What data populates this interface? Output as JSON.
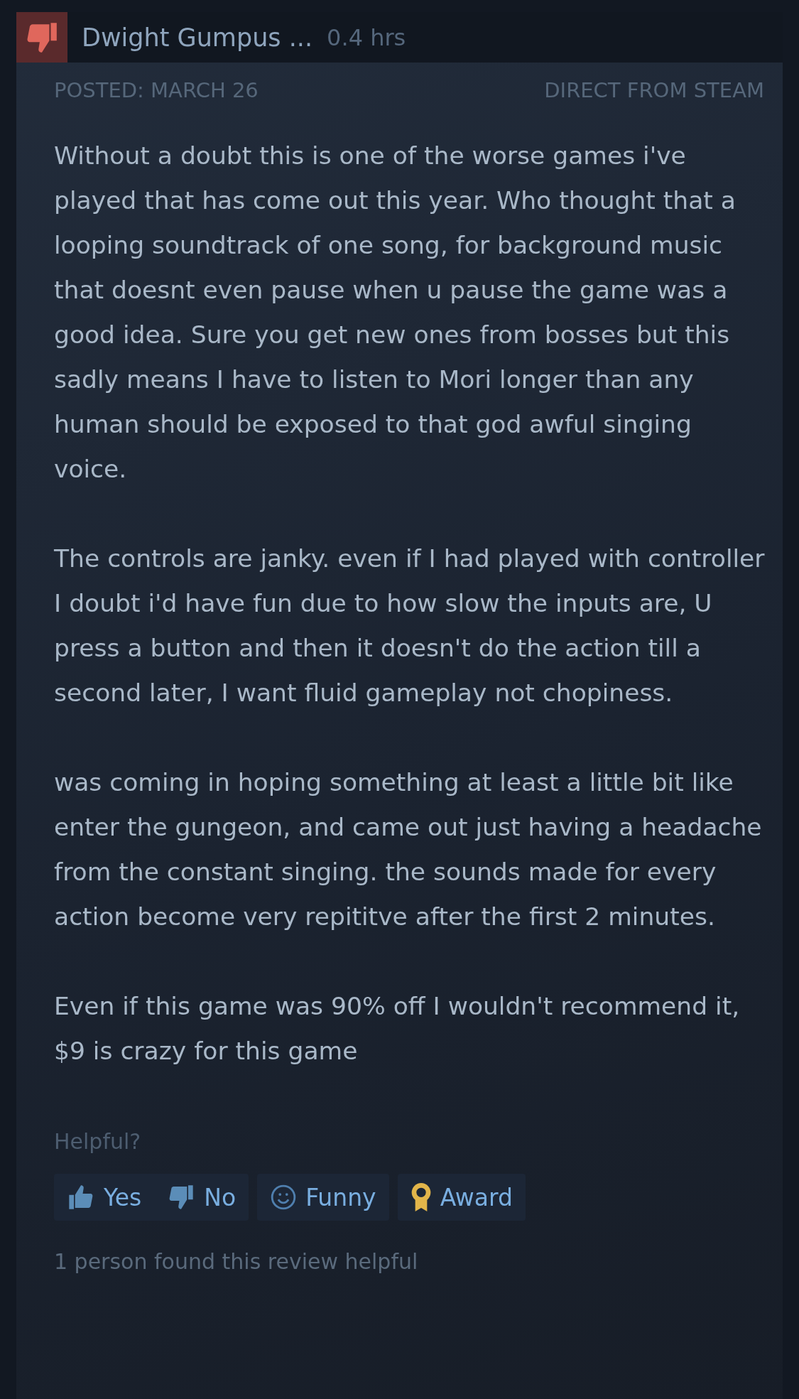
{
  "review": {
    "recommended": false,
    "author": "Dwight Gumpus ...",
    "hours": "0.4 hrs",
    "posted": "POSTED: MARCH 26",
    "source": "DIRECT FROM STEAM",
    "paragraphs": [
      "Without a doubt this is one of the worse games i've played that has come out this year. Who thought that a looping soundtrack of one song, for background music that doesnt even pause when u pause the game was a good idea. Sure you get new ones from bosses but this sadly means I have to listen to Mori longer than any human should be exposed to that god awful singing voice.",
      "The controls are janky. even if I had played with controller I doubt i'd have fun due to how slow the inputs are, U press a button and then it doesn't do the action till a second later, I want fluid gameplay not chopiness.",
      "was coming in hoping something at least a little bit like enter the gungeon, and came out just having a headache from the constant singing. the sounds made for every action become very repititve after the first 2 minutes.",
      "Even if this game was 90% off I wouldn't recommend it, $9 is crazy for this game"
    ]
  },
  "helpful": {
    "prompt": "Helpful?",
    "buttons": [
      {
        "kind": "yes",
        "label": "Yes"
      },
      {
        "kind": "no",
        "label": "No"
      },
      {
        "kind": "funny",
        "label": "Funny"
      },
      {
        "kind": "award",
        "label": "Award"
      }
    ],
    "summary": "1 person found this review helpful"
  }
}
